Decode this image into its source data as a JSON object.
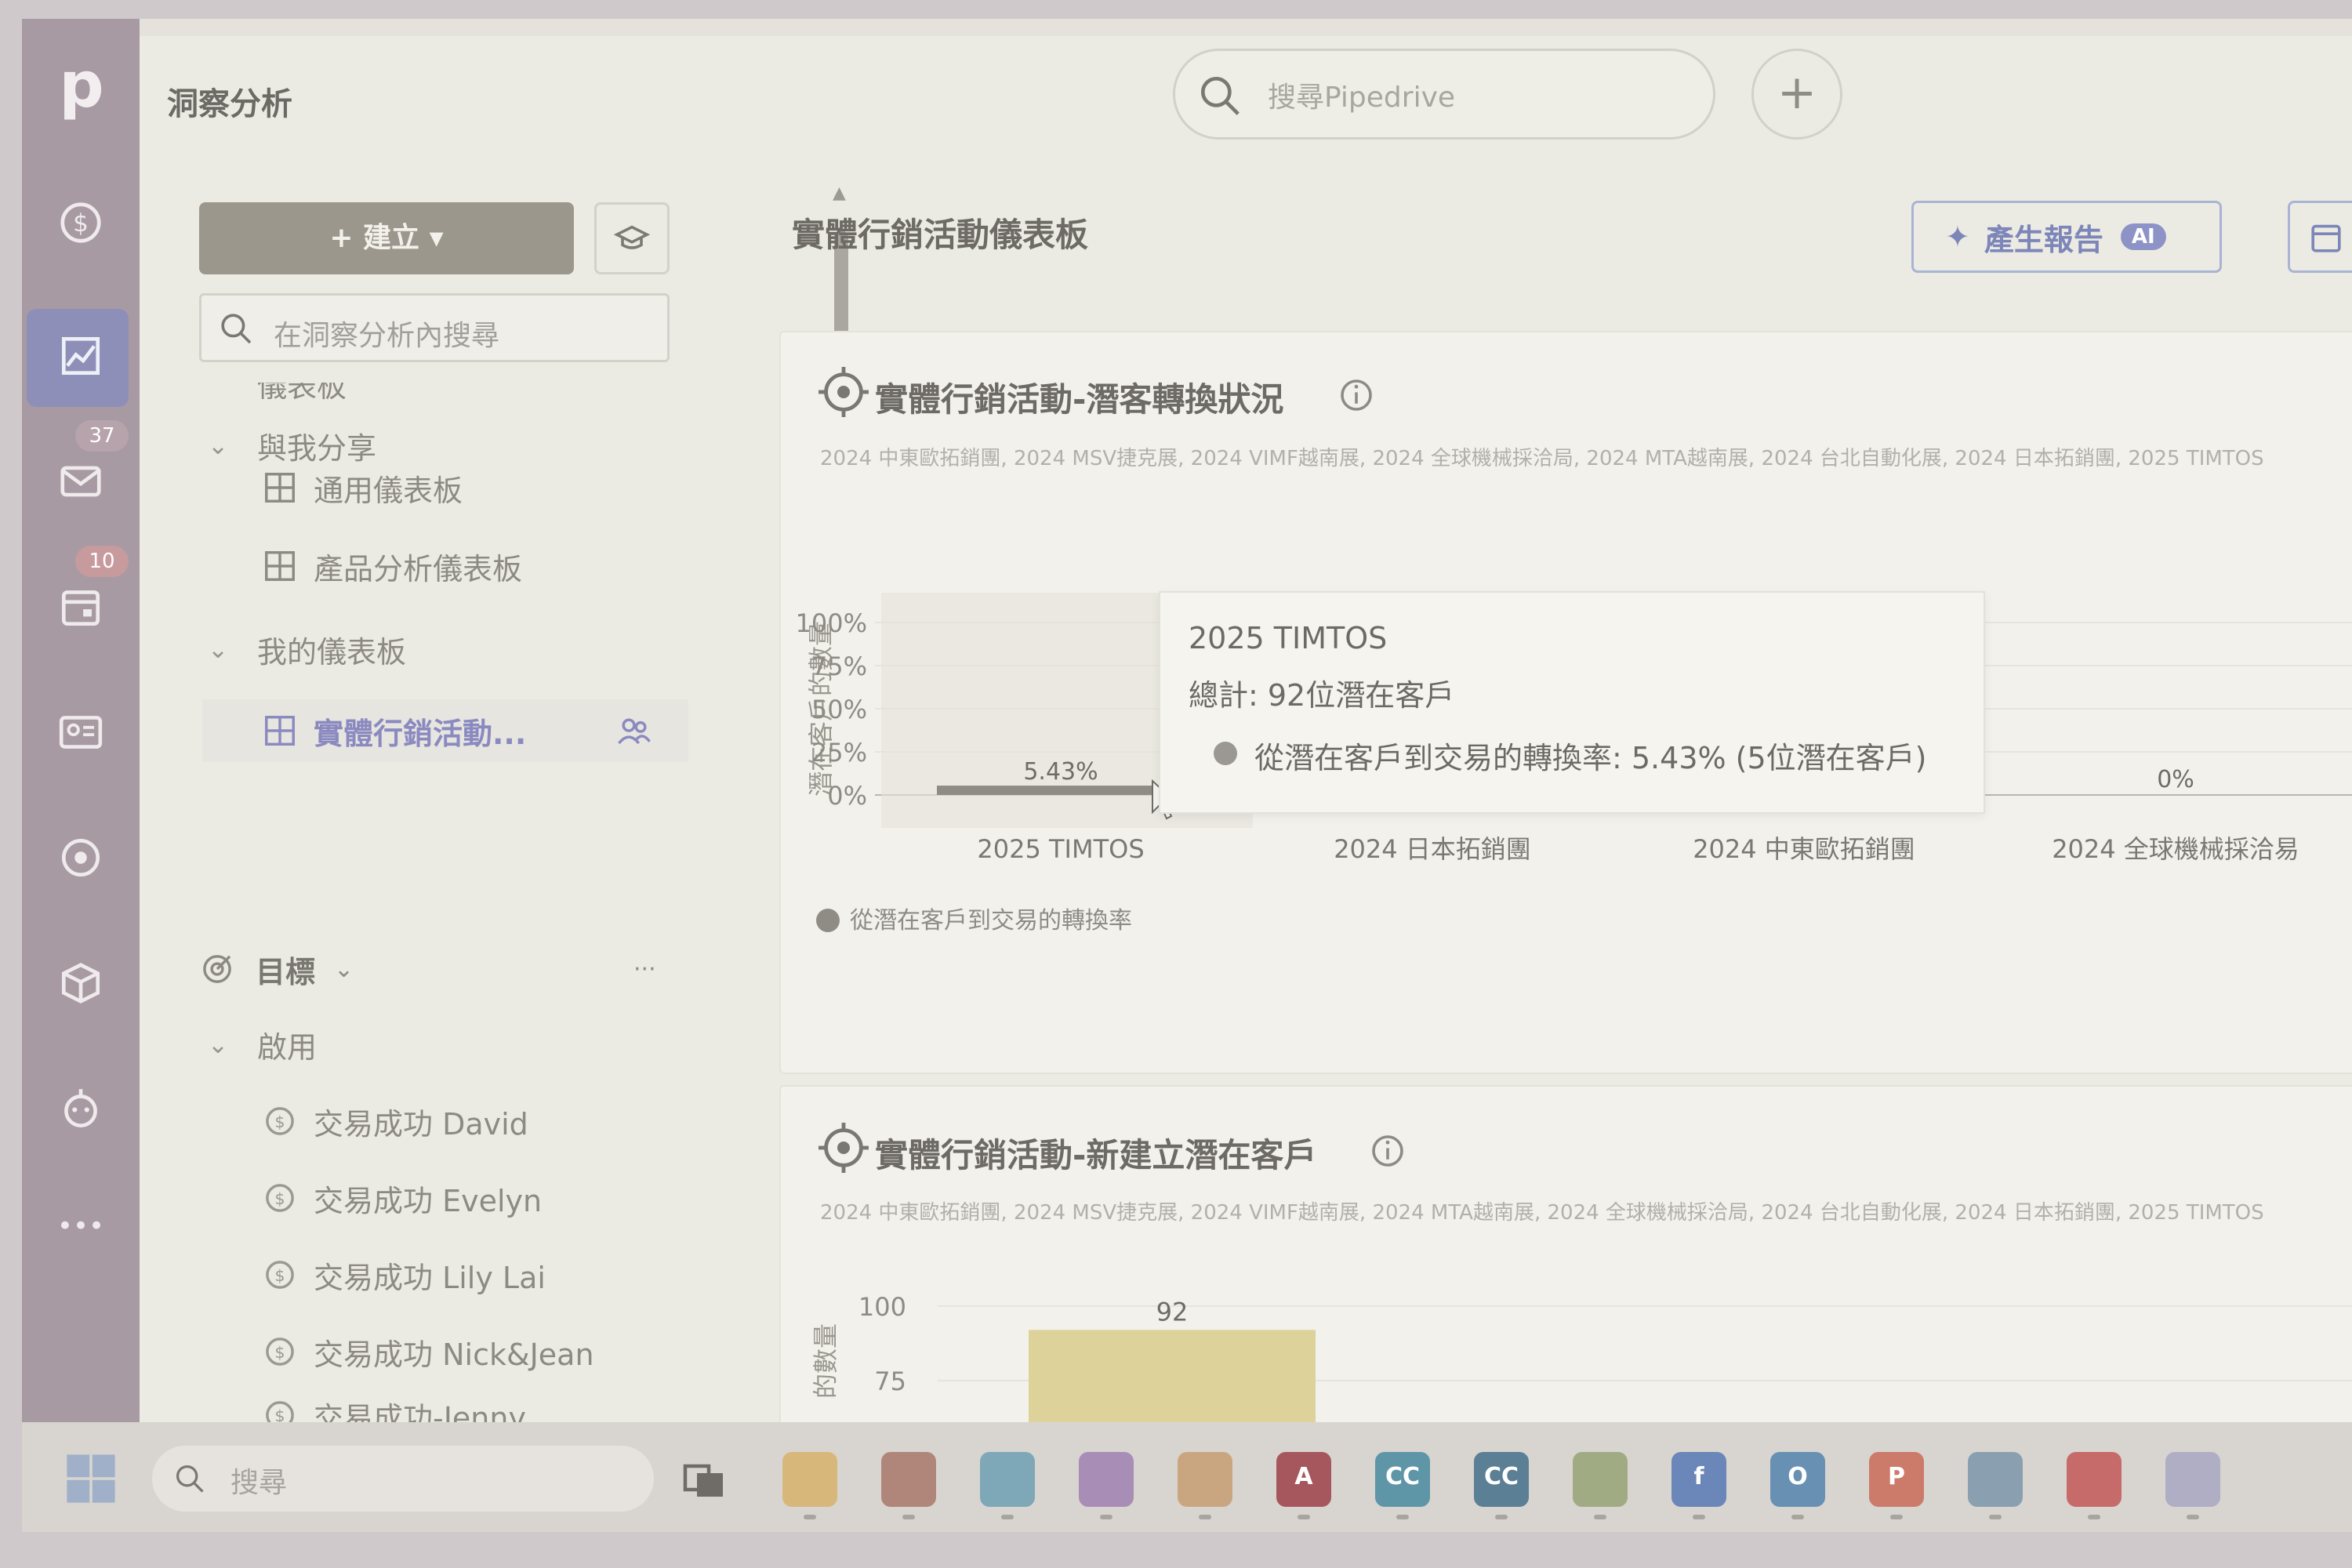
{
  "app": {
    "logo": "p",
    "title": "洞察分析"
  },
  "header": {
    "search_placeholder": "搜尋Pipedrive",
    "add_label": "+"
  },
  "rail": {
    "items": [
      {
        "name": "deals-icon"
      },
      {
        "name": "insights-icon",
        "active": true
      },
      {
        "name": "mail-icon",
        "badge": "37"
      },
      {
        "name": "calendar-icon",
        "badge": "10"
      },
      {
        "name": "contacts-icon"
      },
      {
        "name": "target-icon"
      },
      {
        "name": "products-icon"
      },
      {
        "name": "bot-icon"
      },
      {
        "name": "more-icon",
        "label": "•••"
      }
    ]
  },
  "sidebar": {
    "create_label": "+  建立  ▾",
    "search_placeholder": "在洞察分析內搜尋",
    "cut_item": "儀表板",
    "shared_section": "與我分享",
    "shared_items": [
      "通用儀表板",
      "產品分析儀表板"
    ],
    "my_section": "我的儀表板",
    "my_items": [
      "實體行銷活動..."
    ],
    "goals_label": "目標",
    "goals_more": "···",
    "active_section": "啟用",
    "goal_items": [
      "交易成功 David",
      "交易成功 Evelyn",
      "交易成功 Lily Lai",
      "交易成功 Nick&Jean",
      "交易成功-Jenny"
    ]
  },
  "main": {
    "page_title": "實體行銷活動儀表板",
    "generate_report": "產生報告",
    "ai_badge": "AI"
  },
  "card1": {
    "title": "實體行銷活動-潛客轉換狀況",
    "subtitle": "2024 中東歐拓銷團, 2024 MSV捷克展, 2024 VIMF越南展, 2024 全球機械採洽局, 2024 MTA越南展, 2024 台北自動化展, 2024 日本拓銷團, 2025 TIMTOS",
    "tooltip": {
      "title": "2025 TIMTOS",
      "total": "總計: 92位潛在客戶",
      "line": "從潛在客戶到交易的轉換率: 5.43% (5位潛在客戶)"
    }
  },
  "card2": {
    "title": "實體行銷活動-新建立潛在客戶",
    "subtitle": "2024 中東歐拓銷團, 2024 MSV捷克展, 2024 VIMF越南展, 2024 MTA越南展, 2024 全球機械採洽局, 2024 台北自動化展, 2024 日本拓銷團, 2025 TIMTOS"
  },
  "chart_data": [
    {
      "type": "bar",
      "ylabel": "潛在客戶的數量",
      "y_ticks": [
        "100%",
        "75%",
        "50%",
        "25%",
        "0%"
      ],
      "ylim": [
        0,
        100
      ],
      "categories": [
        "2025 TIMTOS",
        "2024 日本拓銷團",
        "2024 中東歐拓銷團",
        "2024 全球機械採洽易"
      ],
      "series": [
        {
          "name": "從潛在客戶到交易的轉換率",
          "values": [
            5.43,
            0,
            0,
            0
          ]
        }
      ],
      "data_labels": [
        "5.43%",
        "",
        "",
        "0%"
      ],
      "legend": "bottom-left",
      "colors": {
        "bar": "#8f8c85",
        "highlight": "#e4e2da"
      }
    },
    {
      "type": "bar",
      "ylabel": "的數量",
      "y_ticks": [
        "100",
        "75"
      ],
      "categories": [
        "2025 TIMTOS"
      ],
      "values": [
        92
      ],
      "data_labels": [
        "92"
      ],
      "colors": {
        "bar": "#dcd29a"
      }
    }
  ],
  "taskbar": {
    "search_placeholder": "搜尋",
    "apps": [
      {
        "name": "file-explorer-icon",
        "color": "#d7b87a",
        "label": ""
      },
      {
        "name": "store-icon",
        "color": "#b0867a",
        "label": ""
      },
      {
        "name": "edge-icon",
        "color": "#7ea8b8",
        "label": ""
      },
      {
        "name": "m365-icon",
        "color": "#a88db6",
        "label": ""
      },
      {
        "name": "chrome-icon",
        "color": "#c9a680",
        "label": ""
      },
      {
        "name": "access-icon",
        "color": "#a5575d",
        "label": "A"
      },
      {
        "name": "cc-icon",
        "color": "#5e96a8",
        "label": "CC"
      },
      {
        "name": "cc2-icon",
        "color": "#5b7f94",
        "label": "CC"
      },
      {
        "name": "chart-app-icon",
        "color": "#a0ab84",
        "label": ""
      },
      {
        "name": "facebook-icon",
        "color": "#6b86b8",
        "label": "f"
      },
      {
        "name": "outlook-icon",
        "color": "#6890b3",
        "label": "O"
      },
      {
        "name": "powerpoint-icon",
        "color": "#cc7b6b",
        "label": "P"
      },
      {
        "name": "defender-icon",
        "color": "#8aa0b0",
        "label": ""
      },
      {
        "name": "acrobat-icon",
        "color": "#c76a6a",
        "label": ""
      },
      {
        "name": "notepad-icon",
        "color": "#b0aec5",
        "label": ""
      }
    ]
  }
}
